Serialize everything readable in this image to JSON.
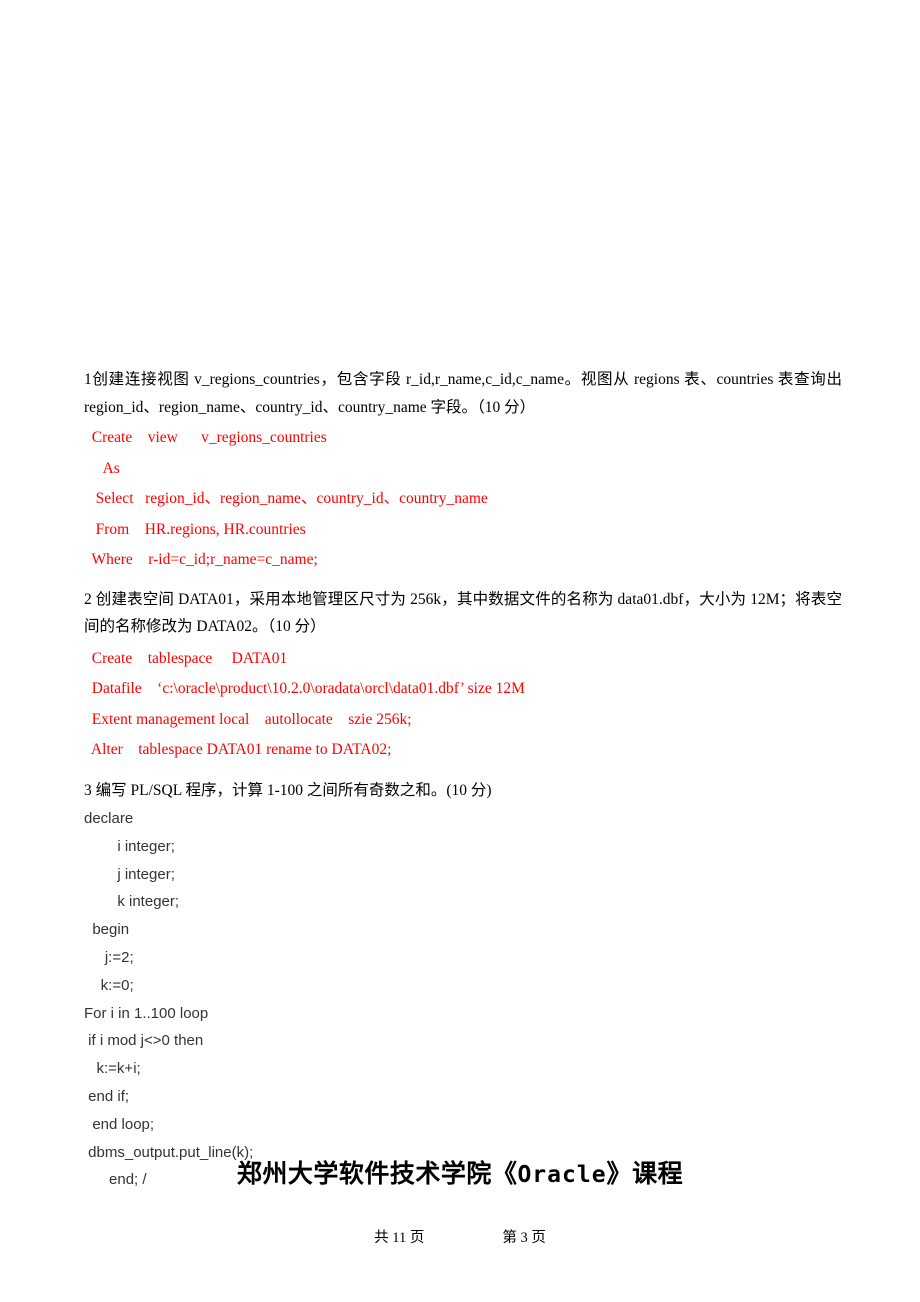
{
  "document": {
    "title": "郑州大学软件技术学院《Oracle》课程",
    "title_plain": "郑州大学软件技术学院",
    "title_course_open": "《",
    "title_course": "Oracle",
    "title_course_close": "》",
    "title_suffix": "课程",
    "accent_color": "#ff0000",
    "body_color": "#000000",
    "answer_color": "#333333"
  },
  "footer": {
    "total_pages": "共 11 页",
    "current_page": "第 3 页"
  },
  "questions": [
    {
      "id": "q1",
      "prompt": "1创建连接视图 v_regions_countries，包含字段 r_id,r_name,c_id,c_name。视图从 regions 表、countries 表查询出 region_id、region_name、country_id、country_name 字段。（10 分）",
      "answer_lines": [
        "  Create    view      v_regions_countries",
        "     As",
        "   Select   region_id、region_name、country_id、country_name",
        "   From    HR.regions, HR.countries",
        "  Where    r-id=c_id;r_name=c_name;"
      ]
    },
    {
      "id": "q2",
      "prompt": "2 创建表空间 DATA01，采用本地管理区尺寸为 256k，其中数据文件的名称为 data01.dbf，大小为 12M；将表空间的名称修改为 DATA02。（10 分）",
      "answer_lines": [
        "  Create    tablespace     DATA01",
        "  Datafile    ‘c:\\oracle\\product\\10.2.0\\oradata\\orcl\\data01.dbf’ size 12M",
        "  Extent management local    autollocate    szie 256k;",
        "  Alter    tablespace DATA01 rename to DATA02;"
      ]
    },
    {
      "id": "q3",
      "prompt": "3 编写 PL/SQL 程序，计算 1-100 之间所有奇数之和。(10 分)",
      "answer_lines": [
        "declare",
        "        i integer;",
        "        j integer;",
        "        k integer;",
        "  begin",
        "     j:=2;",
        "    k:=0;",
        "For i in 1..100 loop",
        " if i mod j<>0 then",
        "   k:=k+i;",
        " end if;",
        "  end loop;",
        " dbms_output.put_line(k);",
        "      end; /"
      ]
    }
  ]
}
